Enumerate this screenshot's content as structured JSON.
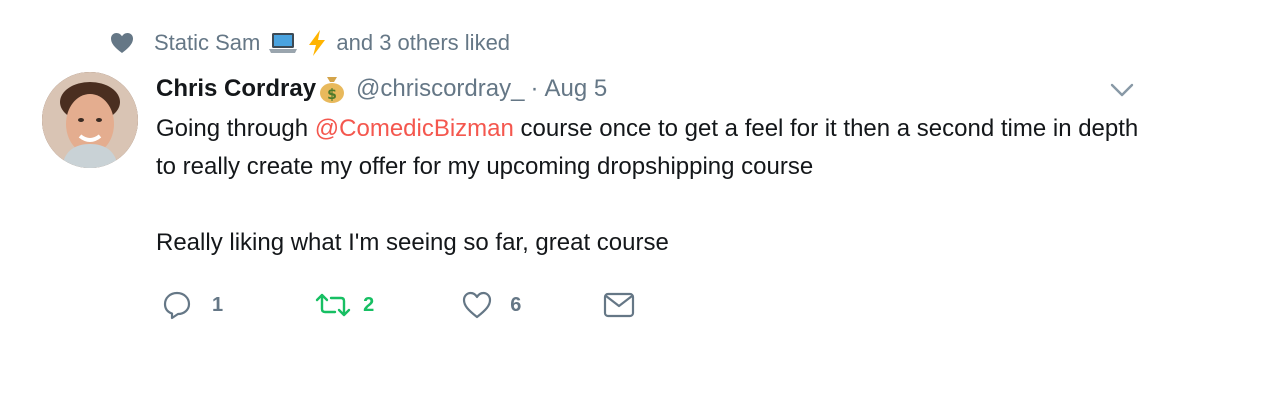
{
  "context": {
    "icon": "heart-icon",
    "user": "Static Sam",
    "emojis": [
      "laptop",
      "lightning-bolt"
    ],
    "text": "and 3 others liked"
  },
  "tweet": {
    "author_name": "Chris Cordray",
    "author_emoji": "money-bag",
    "handle": "@chriscordray_",
    "separator": "·",
    "date": "Aug 5",
    "text_before_mention": "Going through ",
    "mention": "@ComedicBizman",
    "text_after_mention": " course once to get a feel for it then a second time in depth to really create my offer for my upcoming dropshipping course",
    "text_paragraph2": "Really liking what I'm seeing so far, great course"
  },
  "actions": {
    "reply_count": "1",
    "retweet_count": "2",
    "like_count": "6"
  },
  "colors": {
    "muted": "#657786",
    "mention": "#f4574e",
    "retweet": "#17bf63",
    "text": "#14171a"
  }
}
